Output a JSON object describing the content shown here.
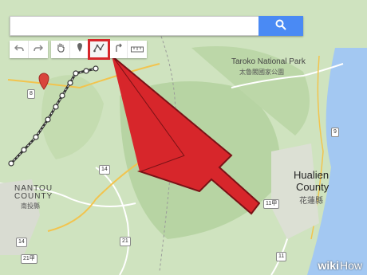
{
  "search": {
    "value": "",
    "placeholder": ""
  },
  "toolbar": {
    "icons": [
      "undo-icon",
      "redo-icon",
      "hand-icon",
      "marker-icon",
      "draw-line-icon",
      "directions-icon",
      "ruler-icon"
    ],
    "active": "draw-line-icon",
    "highlight_color": "#d7262b"
  },
  "map": {
    "labels": {
      "taroko": "Taroko National Park",
      "taroko_cjk": "太魯閣國家公園",
      "hualien1": "Hualien",
      "hualien2": "County",
      "hualien_cjk": "花蓮縣",
      "nantou1": "NANTOU",
      "nantou2": "COUNTY",
      "nantou_cjk": "南投縣"
    },
    "roads": [
      "8",
      "14",
      "21",
      "14",
      "11",
      "21甲",
      "11甲",
      "9"
    ]
  },
  "arrow_color": "#d7262b",
  "sea_color": "#a3c8f2",
  "watermark": {
    "wiki": "wiki",
    "how": "How"
  }
}
